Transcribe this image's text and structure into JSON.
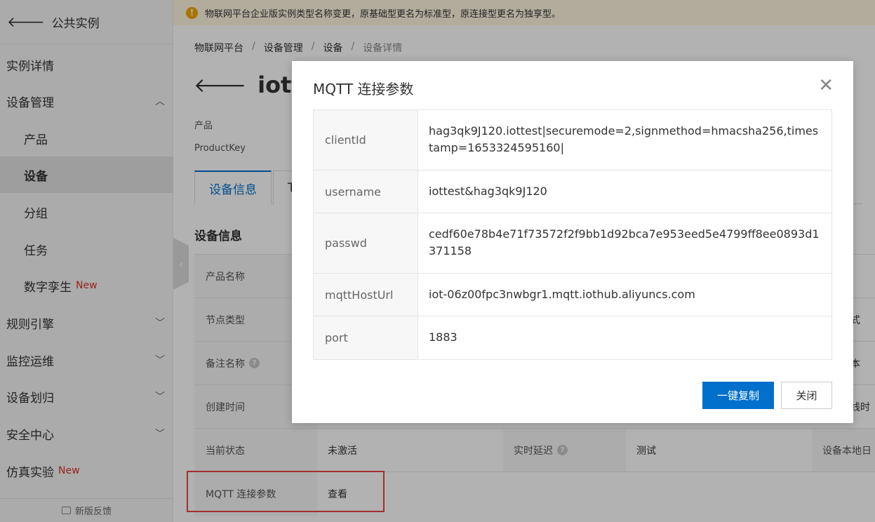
{
  "sidebar": {
    "back_label": "公共实例",
    "items": [
      {
        "label": "实例详情"
      },
      {
        "label": "设备管理"
      },
      {
        "label": "产品"
      },
      {
        "label": "设备"
      },
      {
        "label": "分组"
      },
      {
        "label": "任务"
      },
      {
        "label": "数字孪生",
        "badge": "New"
      },
      {
        "label": "规则引擎"
      },
      {
        "label": "监控运维"
      },
      {
        "label": "设备划归"
      },
      {
        "label": "安全中心"
      },
      {
        "label": "仿真实验",
        "badge": "New"
      }
    ],
    "feedback_label": "新版反馈"
  },
  "notice": {
    "text": "物联网平台企业版实例类型名称变更，原基础型更名为标准型，原连接型更名为独享型。"
  },
  "breadcrumb": [
    "物联网平台",
    "设备管理",
    "设备",
    "设备详情"
  ],
  "page": {
    "title": "iottest",
    "product_label": "产品",
    "productkey_label": "ProductKey",
    "tabs": [
      "设备信息",
      "T"
    ],
    "section_title": "设备信息"
  },
  "info_rows": {
    "product_name": "产品名称",
    "node_type": "节点类型",
    "remark_name": "备注名称",
    "created_time": "创建时间",
    "current_status": "当前状态",
    "current_status_value": "未激活",
    "realtime_delay": "实时延迟",
    "test_link": "测试",
    "device_local_time": "设备本地日",
    "mqtt_params": "MQTT 连接参数",
    "view_link": "查看",
    "right_col_1": "式",
    "right_col_2": "本",
    "right_col_3": "线时"
  },
  "modal": {
    "title": "MQTT 连接参数",
    "params": [
      {
        "key": "clientId",
        "value": "hag3qk9J120.iottest|securemode=2,signmethod=hmacsha256,timestamp=1653324595160|"
      },
      {
        "key": "username",
        "value": "iottest&hag3qk9J120"
      },
      {
        "key": "passwd",
        "value": "cedf60e78b4e71f73572f2f9bb1d92bca7e953eed5e4799ff8ee0893d1371158"
      },
      {
        "key": "mqttHostUrl",
        "value": "iot-06z00fpc3nwbgr1.mqtt.iothub.aliyuncs.com"
      },
      {
        "key": "port",
        "value": "1883"
      }
    ],
    "copy_button": "一键复制",
    "close_button": "关闭"
  }
}
